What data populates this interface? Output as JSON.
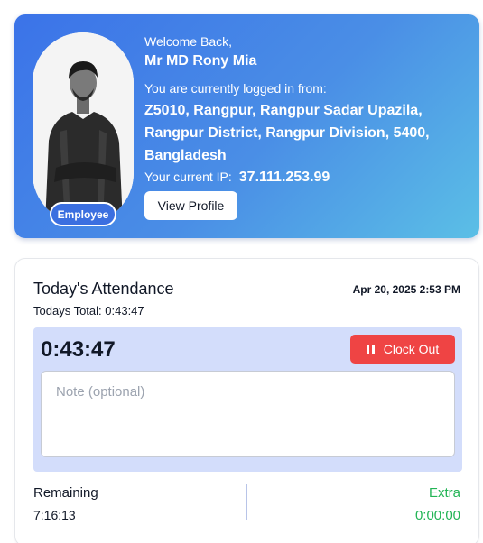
{
  "profile": {
    "welcome": "Welcome Back,",
    "name": "Mr MD Rony Mia",
    "login_label": "You are currently logged in from:",
    "location": "Z5010, Rangpur, Rangpur Sadar Upazila, Rangpur District, Rangpur Division, 5400, Bangladesh",
    "ip_label": "Your current IP:",
    "ip": "37.111.253.99",
    "role_badge": "Employee",
    "view_profile_label": "View Profile"
  },
  "attendance": {
    "title": "Today's Attendance",
    "datetime": "Apr 20, 2025 2:53 PM",
    "todays_total_label": "Todays Total:",
    "todays_total": "0:43:47",
    "timer": "0:43:47",
    "clock_out_label": "Clock Out",
    "note_placeholder": "Note (optional)",
    "remaining_label": "Remaining",
    "remaining_value": "7:16:13",
    "extra_label": "Extra",
    "extra_value": "0:00:00"
  },
  "colors": {
    "accent_blue": "#3b73e8",
    "clock_out_red": "#ef4444",
    "extra_green": "#22b455",
    "timer_panel": "#d3ddfb"
  },
  "icons": {
    "clock_out": "pause-icon"
  }
}
